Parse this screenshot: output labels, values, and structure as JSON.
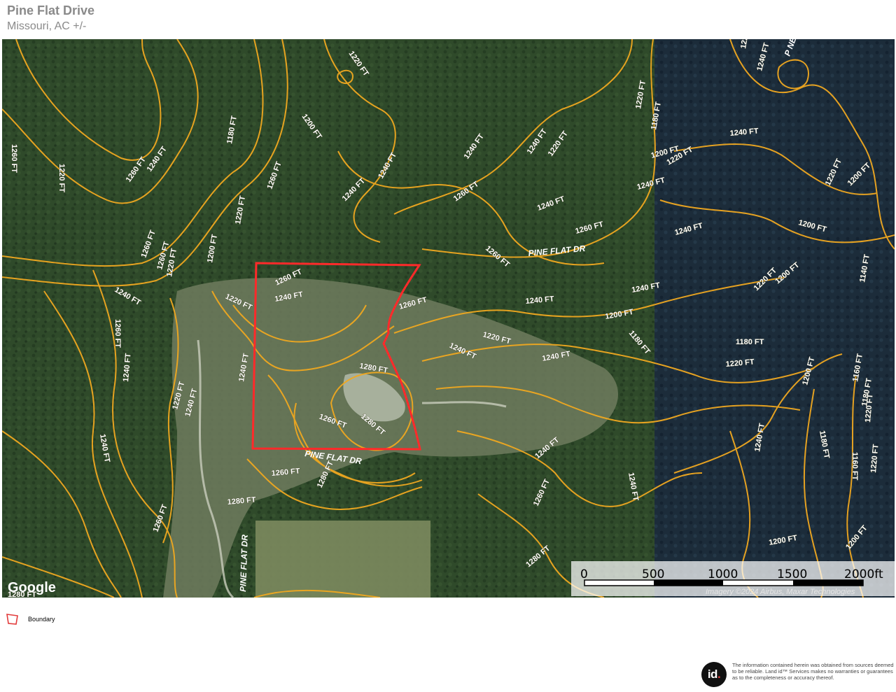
{
  "header": {
    "title": "Pine Flat Drive",
    "subtitle": "Missouri,  AC +/-"
  },
  "map": {
    "colors": {
      "forest": "#2f4a2a",
      "forest_dark": "#1c2c3a",
      "clearing": "#7f8a70",
      "contour": "#f0a820",
      "boundary": "#ff2a2a"
    },
    "road_labels": [
      "PINE FLAT DR",
      "PINE FLAT DR",
      "PINE FLAT DR"
    ],
    "contour_labels": [
      "1180 FT",
      "1200 FT",
      "1220 FT",
      "1240 FT",
      "1260 FT",
      "1280 FT",
      "1160 FT",
      "1140 FT"
    ],
    "google_label": "Google",
    "attribution": "Imagery ©2024 Airbus, Maxar Technologies"
  },
  "scale_bar": {
    "labels": [
      "0",
      "500",
      "1000",
      "1500",
      "2000ft"
    ]
  },
  "legend": {
    "boundary_label": "Boundary"
  },
  "footer": {
    "logo_text": "id",
    "logo_dot": ".",
    "disclaimer": "The information contained herein was obtained from sources deemed to be reliable. Land id™ Services makes no warranties or guarantees as to the completeness or accuracy thereof."
  }
}
